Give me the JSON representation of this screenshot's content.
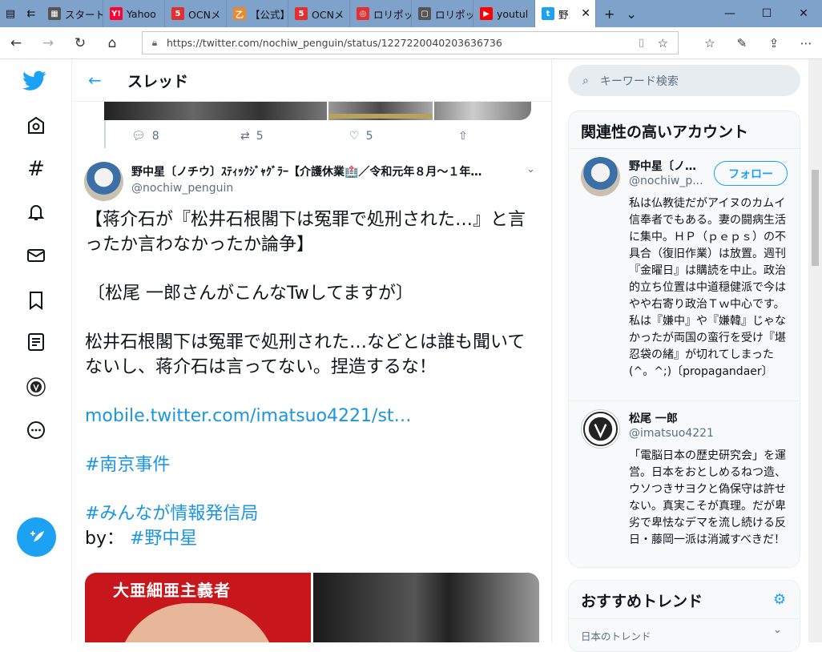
{
  "browser": {
    "tabs": [
      {
        "label": "スタート",
        "color": "#555555",
        "glyph": "▦"
      },
      {
        "label": "Yahoo",
        "color": "#ff0033",
        "glyph": "Y!"
      },
      {
        "label": "OCNメ",
        "color": "#e03030",
        "glyph": "5"
      },
      {
        "label": "【公式】",
        "color": "#e98a2f",
        "glyph": "乙"
      },
      {
        "label": "OCNメ",
        "color": "#e03030",
        "glyph": "5"
      },
      {
        "label": "ロリポッ",
        "color": "#e03030",
        "glyph": "◎"
      },
      {
        "label": "ロリポッ",
        "color": "#555555",
        "glyph": "▢"
      },
      {
        "label": "youtul",
        "color": "#ff0000",
        "glyph": "▶"
      },
      {
        "label": "野",
        "color": "#1da1f2",
        "glyph": "t"
      }
    ],
    "url": "https://twitter.com/nochiw_penguin/status/1227220040203636736"
  },
  "main": {
    "header_title": "スレッド",
    "prev_actions": {
      "reply_count": "8",
      "retweet_count": "5",
      "like_count": "5"
    },
    "tweet": {
      "display_name": "野中星〔ノチウ〕ｽﾃｨｯｸｼﾞｬｸﾞﾗｰ【介護休業🏥／令和元年８月～１年…",
      "handle": "@nochiw_penguin",
      "line1": "【蒋介石が『松井石根閣下は冤罪で処刑された…』と言ったか言わなかったか論争】",
      "line2": "〔松尾 一郎さんがこんなTwしてますが〕",
      "line3": "松井石根閣下は冤罪で処刑された…などとは誰も聞いてないし、蒋介石は言ってない。捏造するな！",
      "link": "mobile.twitter.com/imatsuo4221/st…",
      "hashtag1": "#南京事件",
      "hashtag2": "#みんなが情報発信局",
      "by_prefix": "by：",
      "by_tag": "#野中星"
    },
    "image_caption": "大亜細亜主義者"
  },
  "sidebar": {
    "search_placeholder": "キーワード検索",
    "related_title": "関連性の高いアカウント",
    "accounts": [
      {
        "name": "野中星〔ノ…",
        "handle": "@nochiw_p...",
        "follow_label": "フォロー",
        "bio": "私は仏教徒だがアイヌのカムイ信奉者でもある。妻の闘病生活に集中。ＨＰ（ｐｅｐｓ）の不具合（復旧作業）は放置。週刊『金曜日』は購読を中止。政治的立ち位置は中道穏健派で今はやや右寄り政治Ｔｗ中心です。私は『嫌中』や『嫌韓』じゃなかったが両国の蛮行を受け『堪忍袋の緒』が切れてしまった(^。^;)〔propagandaer〕"
      },
      {
        "name": "松尾 一郎",
        "handle": "@imatsuo4221",
        "bio": "「電脳日本の歴史研究会」を運営。日本をおとしめるねつ造、ウソつきサヨクと偽保守は許せない。真実こそが真理。だが卑劣で卑怯なデマを流し続ける反日・藤岡一派は消滅すべきだ！"
      }
    ],
    "trends_title": "おすすめトレンド",
    "trends_sub": "日本のトレンド"
  },
  "colors": {
    "accent": "#1da1f2",
    "tabbar": "#7ea2c9"
  }
}
